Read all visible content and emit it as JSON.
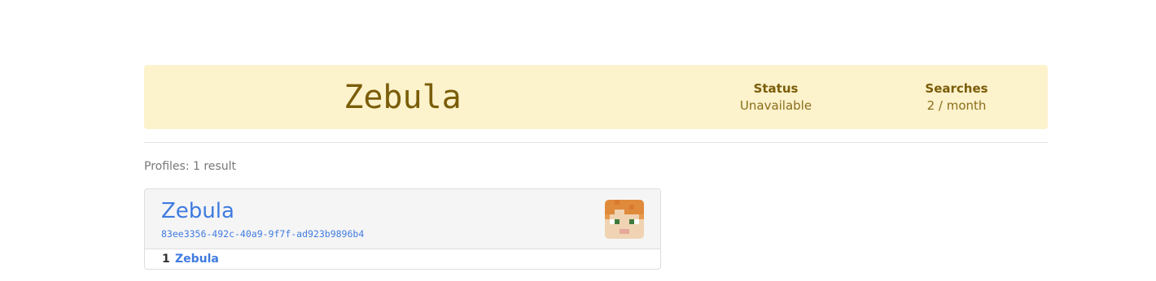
{
  "banner": {
    "name": "Zebula",
    "status_label": "Status",
    "status_value": "Unavailable",
    "searches_label": "Searches",
    "searches_value": "2 / month"
  },
  "results": {
    "heading": "Profiles: 1 result"
  },
  "profile": {
    "name": "Zebula",
    "uuid": "83ee3356-492c-40a9-9f7f-ad923b9896b4",
    "avatar_icon": "player-skin-head-icon",
    "history": [
      {
        "index": "1",
        "name": "Zebula"
      }
    ]
  },
  "colors": {
    "banner_bg": "#fcf2cc",
    "banner_text": "#7a5d08",
    "link": "#3f7be0"
  }
}
